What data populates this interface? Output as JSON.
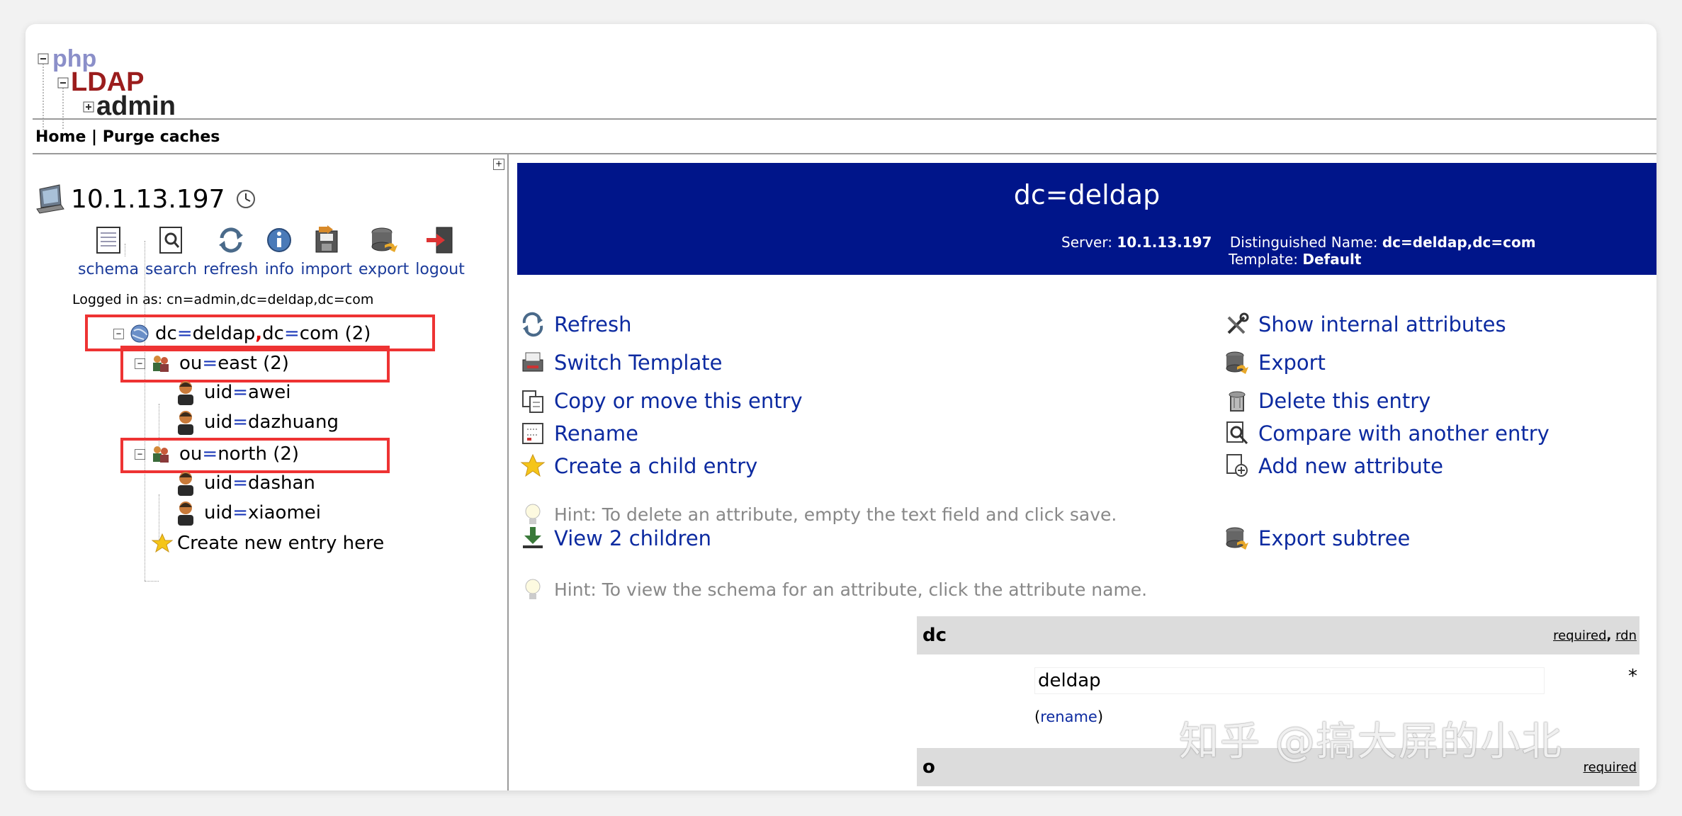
{
  "logo": {
    "php": "php",
    "ldap": "LDAP",
    "admin": "admin"
  },
  "nav": {
    "home": "Home",
    "separator": "|",
    "purge": "Purge caches"
  },
  "server": {
    "ip": "10.1.13.197"
  },
  "toolbar": [
    "schema",
    "search",
    "refresh",
    "info",
    "import",
    "export",
    "logout"
  ],
  "logged_in": "Logged in as: cn=admin,dc=deldap,dc=com",
  "tree": {
    "root": {
      "a": "dc",
      "eq": "=",
      "b": "deldap",
      "comma": ",",
      "c": "dc",
      "d": "com",
      "count": "(2)"
    },
    "east": {
      "a": "ou",
      "eq": "=",
      "b": "east",
      "count": "(2)"
    },
    "awei": {
      "a": "uid",
      "eq": "=",
      "b": "awei"
    },
    "dazhuang": {
      "a": "uid",
      "eq": "=",
      "b": "dazhuang"
    },
    "north": {
      "a": "ou",
      "eq": "=",
      "b": "north",
      "count": "(2)"
    },
    "dashan": {
      "a": "uid",
      "eq": "=",
      "b": "dashan"
    },
    "xiaomei": {
      "a": "uid",
      "eq": "=",
      "b": "xiaomei"
    },
    "create": "Create new entry here"
  },
  "entry": {
    "title": "dc=deldap",
    "server_label": "Server:",
    "server_value": "10.1.13.197",
    "dn_label": "Distinguished Name:",
    "dn_value": "dc=deldap,dc=com",
    "template_label": "Template:",
    "template_value": "Default"
  },
  "actions_left": [
    "Refresh",
    "Switch Template",
    "Copy or move this entry",
    "Rename",
    "Create a child entry"
  ],
  "actions_right": [
    "Show internal attributes",
    "Export",
    "Delete this entry",
    "Compare with another entry",
    "Add new attribute"
  ],
  "hint1": "Hint: To delete an attribute, empty the text field and click save.",
  "view_children": "View 2 children",
  "export_subtree": "Export subtree",
  "hint2": "Hint: To view the schema for an attribute, click the attribute name.",
  "attrs": {
    "dc": {
      "name": "dc",
      "required": "required",
      "sep": ",",
      "rdn": "rdn",
      "value": "deldap",
      "star": "*",
      "rename_open": "(",
      "rename": "rename",
      "rename_close": ")"
    },
    "o": {
      "name": "o",
      "required": "required"
    }
  },
  "watermark": "知乎 @搞大屏的小北",
  "colors": {
    "header_bg": "#00158a",
    "link": "#0c2aa0",
    "highlight": "#e33333"
  }
}
